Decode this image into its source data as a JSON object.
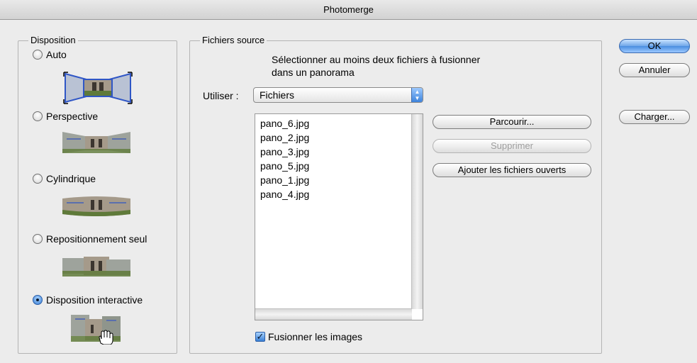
{
  "window": {
    "title": "Photomerge"
  },
  "disposition": {
    "legend": "Disposition",
    "options": [
      {
        "label": "Auto",
        "selected": false
      },
      {
        "label": "Perspective",
        "selected": false
      },
      {
        "label": "Cylindrique",
        "selected": false
      },
      {
        "label": "Repositionnement seul",
        "selected": false
      },
      {
        "label": "Disposition interactive",
        "selected": true
      }
    ]
  },
  "source": {
    "legend": "Fichiers source",
    "instruction_line1": "Sélectionner au moins deux fichiers à fusionner",
    "instruction_line2": "dans un panorama",
    "use_label": "Utiliser :",
    "use_value": "Fichiers",
    "files": [
      "pano_6.jpg",
      "pano_2.jpg",
      "pano_3.jpg",
      "pano_5.jpg",
      "pano_1.jpg",
      "pano_4.jpg"
    ],
    "browse_label": "Parcourir...",
    "remove_label": "Supprimer",
    "add_open_label": "Ajouter les fichiers ouverts",
    "blend_label": "Fusionner les images",
    "blend_checked": true
  },
  "actions": {
    "ok_label": "OK",
    "cancel_label": "Annuler",
    "load_label": "Charger..."
  },
  "colors": {
    "accent": "#4a8ee0",
    "sky": "#5a6fae",
    "stone": "#a59a8a",
    "grass": "#5f7a3a"
  }
}
